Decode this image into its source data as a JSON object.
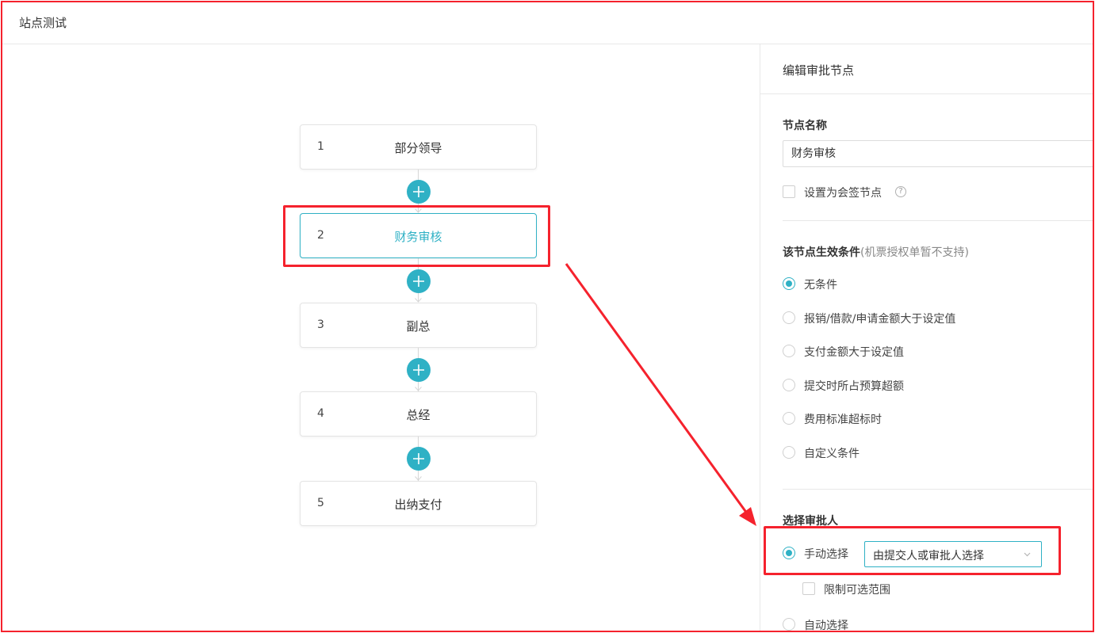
{
  "header": {
    "title": "站点测试"
  },
  "flow": {
    "nodes": [
      {
        "num": "1",
        "label": "部分领导"
      },
      {
        "num": "2",
        "label": "财务审核"
      },
      {
        "num": "3",
        "label": "副总"
      },
      {
        "num": "4",
        "label": "总经"
      },
      {
        "num": "5",
        "label": "出纳支付"
      }
    ],
    "active_node": "2"
  },
  "panel": {
    "title": "编辑审批节点",
    "node_name_label": "节点名称",
    "node_name_value": "财务审核",
    "countersign_label": "设置为会签节点",
    "help_glyph": "?",
    "condition_title": "该节点生效条件",
    "condition_note": "(机票授权单暂不支持)",
    "conditions": [
      "无条件",
      "报销/借款/申请金额大于设定值",
      "支付金额大于设定值",
      "提交时所占预算超额",
      "费用标准超标时",
      "自定义条件"
    ],
    "selected_condition": "无条件",
    "approver_title": "选择审批人",
    "manual_label": "手动选择",
    "manual_select_value": "由提交人或审批人选择",
    "limit_label": "限制可选范围",
    "auto_label": "自动选择"
  },
  "colors": {
    "accent": "#2fb1c5",
    "annotation": "#f5222d",
    "border": "#e4e4e4"
  }
}
